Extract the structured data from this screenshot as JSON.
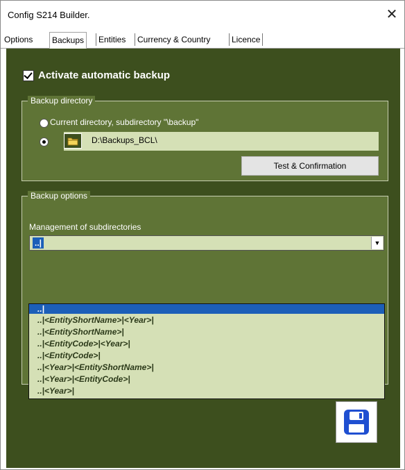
{
  "window": {
    "title": "Config S214 Builder.",
    "close_icon": "close-icon"
  },
  "tabs": [
    {
      "label": "Options"
    },
    {
      "label": "Backups",
      "selected": true
    },
    {
      "label": "Entities"
    },
    {
      "label": "Currency & Country"
    },
    {
      "label": "Licence"
    }
  ],
  "backup": {
    "activate_label": "Activate automatic backup",
    "activate_checked": true
  },
  "backup_directory": {
    "group_title": "Backup directory",
    "option_current_label": "Current directory, subdirectory \"\\backup\"",
    "option_current_selected": false,
    "option_custom_selected": true,
    "custom_path": "D:\\Backups_BCL\\",
    "folder_icon": "folder-icon",
    "test_button_label": "Test & Confirmation"
  },
  "backup_options": {
    "group_title": "Backup options",
    "management_label": "Management of subdirectories",
    "selected_value": "..|",
    "dropdown_items": [
      "..|",
      "..|<EntityShortName>|<Year>|",
      "..|<EntityShortName>|",
      "..|<EntityCode>|<Year>|",
      "..|<EntityCode>|",
      "..|<Year>|<EntityShortName>|",
      "..|<Year>|<EntityCode>|",
      "..|<Year>|"
    ],
    "selected_index": 0
  },
  "save_button": {
    "icon": "save-icon"
  },
  "colors": {
    "panel_bg": "#3d4f1e",
    "group_bg": "#5f7436",
    "field_bg": "#d5e0b6",
    "selection": "#1c5fb8"
  }
}
